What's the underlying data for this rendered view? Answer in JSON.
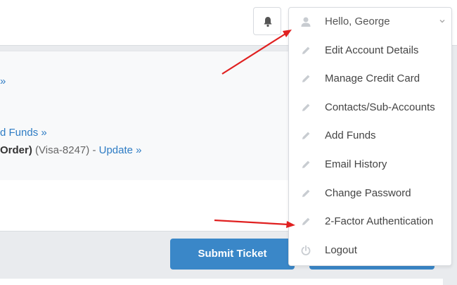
{
  "header": {
    "greeting": "Hello, George"
  },
  "panel": {
    "line1_link": "»",
    "line2_link": "d Funds »",
    "line3_strong": "Order)",
    "line3_card": " (Visa-8247) - ",
    "line3_link": "Update »"
  },
  "buttons": {
    "submit_ticket": "Submit Ticket"
  },
  "account_menu": {
    "items": [
      {
        "label": "Edit Account Details",
        "icon": "pencil-icon"
      },
      {
        "label": "Manage Credit Card",
        "icon": "pencil-icon"
      },
      {
        "label": "Contacts/Sub-Accounts",
        "icon": "pencil-icon"
      },
      {
        "label": "Add Funds",
        "icon": "pencil-icon"
      },
      {
        "label": "Email History",
        "icon": "pencil-icon"
      },
      {
        "label": "Change Password",
        "icon": "pencil-icon"
      },
      {
        "label": "2-Factor Authentication",
        "icon": "pencil-icon"
      },
      {
        "label": "Logout",
        "icon": "power-icon"
      }
    ]
  },
  "colors": {
    "link": "#2e7cc4",
    "button": "#3a87c8",
    "annotation_arrow": "#e02020",
    "icon_gray": "#c8ccd1"
  }
}
